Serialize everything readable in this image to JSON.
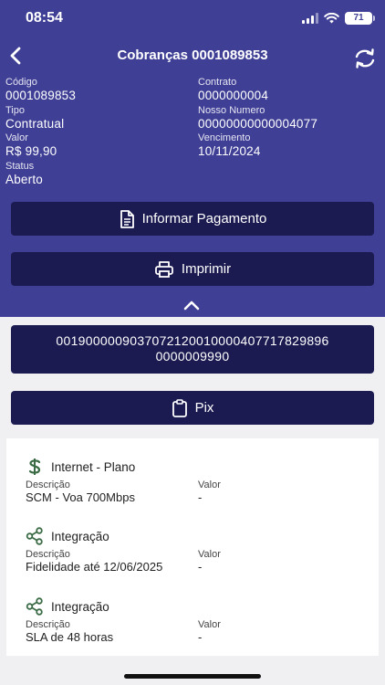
{
  "status_bar": {
    "time": "08:54",
    "battery": "71"
  },
  "header": {
    "title": "Cobranças 0001089853"
  },
  "fields": {
    "codigo": {
      "label": "Código",
      "value": "0001089853"
    },
    "contrato": {
      "label": "Contrato",
      "value": "0000000004"
    },
    "tipo": {
      "label": "Tipo",
      "value": "Contratual"
    },
    "nosso_numero": {
      "label": "Nosso Numero",
      "value": "00000000000004077"
    },
    "valor": {
      "label": "Valor",
      "value": "R$ 99,90"
    },
    "vencimento": {
      "label": "Vencimento",
      "value": "10/11/2024"
    },
    "status": {
      "label": "Status",
      "value": "Aberto"
    }
  },
  "actions": {
    "informar_pagamento": "Informar Pagamento",
    "imprimir": "Imprimir",
    "pix": "Pix"
  },
  "barcode": {
    "line1": "00190000090370721200100004077178298​96",
    "line2": "0000009990"
  },
  "items": [
    {
      "icon": "dollar-icon",
      "name": "Internet - Plano",
      "desc_label": "Descrição",
      "desc": "SCM - Voa 700Mbps",
      "valor_label": "Valor",
      "valor": "-"
    },
    {
      "icon": "share-icon",
      "name": "Integração",
      "desc_label": "Descrição",
      "desc": "Fidelidade até 12/06/2025",
      "valor_label": "Valor",
      "valor": "-"
    },
    {
      "icon": "share-icon",
      "name": "Integração",
      "desc_label": "Descrição",
      "desc": "SLA de 48 horas",
      "valor_label": "Valor",
      "valor": "-"
    }
  ],
  "colors": {
    "header_bg": "#3f3f96",
    "button_bg": "#1b1b52",
    "icon_green": "#3a6b45"
  }
}
